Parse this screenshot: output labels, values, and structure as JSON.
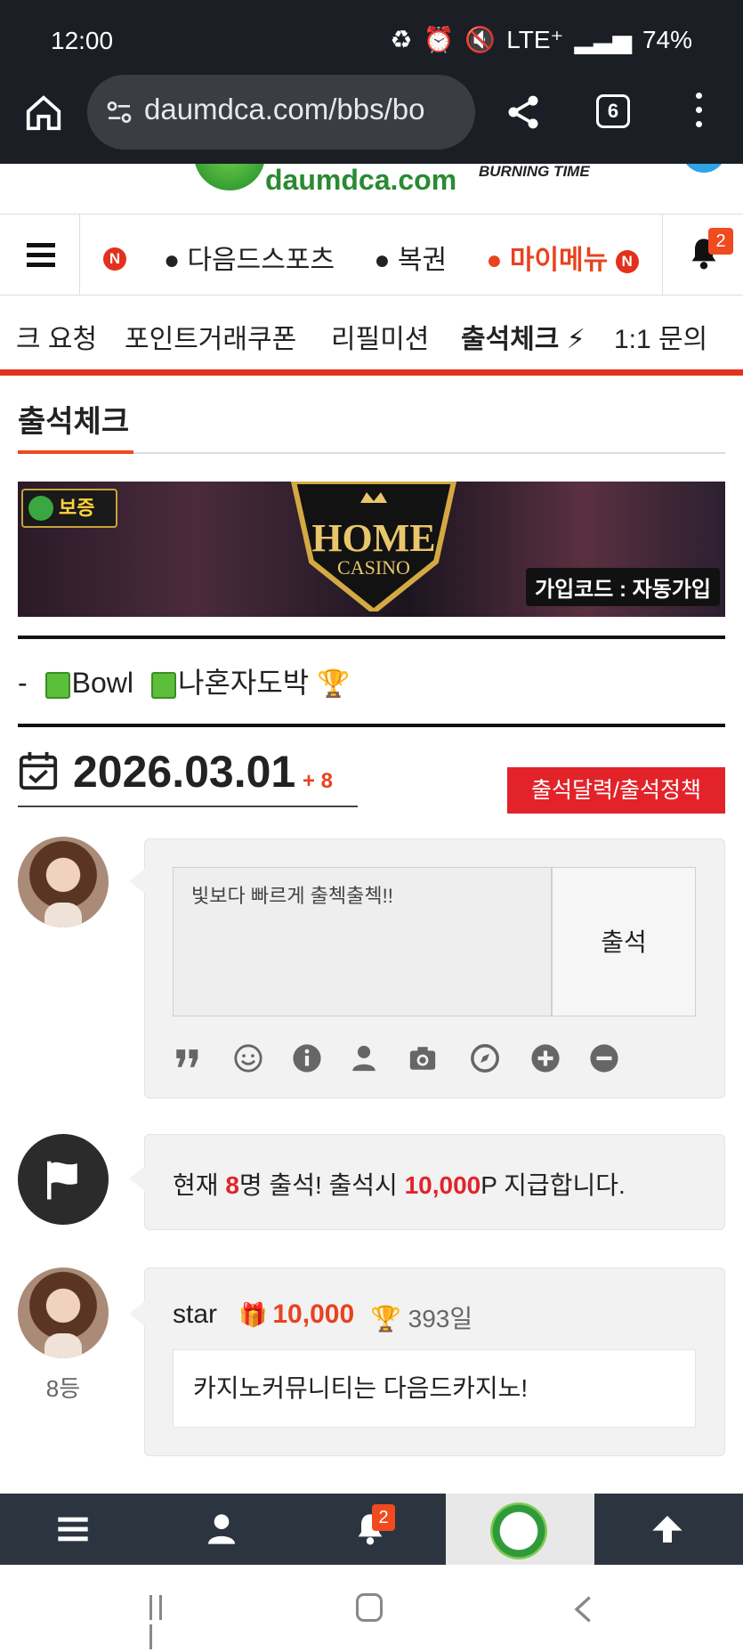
{
  "statusbar": {
    "time": "12:00",
    "network": "LTE⁺",
    "battery": "74%"
  },
  "browser": {
    "url": "daumdca.com/bbs/bo",
    "tab_count": "6"
  },
  "logo": {
    "site": "daumdca.com",
    "partner": "BURNING TIME"
  },
  "nav": {
    "new_badge": "N",
    "items": [
      "● 다음드스포츠",
      "● 복권"
    ],
    "mymenu_label": "● 마이메뉴",
    "mymenu_badge": "N",
    "notification_count": "2"
  },
  "submenu": {
    "items": [
      "크 요청",
      "포인트거래쿠폰",
      "리필미션",
      "출석체크",
      "1:1 문의"
    ],
    "active": "출석체크"
  },
  "page": {
    "title": "출석체크"
  },
  "banner": {
    "warranty": "보증",
    "brand": "HOME",
    "brand_sub": "CASINO",
    "signup_code": "가입코드 : 자동가입"
  },
  "ticker": {
    "prefix": "-",
    "item1": "Bowl",
    "item2": "나혼자도박"
  },
  "attendance": {
    "date": "2026.03.01",
    "delta": "+ 8",
    "calendar_button": "출석달력/출석정책",
    "comment_placeholder": "빛보다 빠르게 출첵출첵!!",
    "submit_button": "출석"
  },
  "notice": {
    "pre": "현재 ",
    "count": "8",
    "mid": "명 출석! 출석시 ",
    "points": "10,000",
    "post": "P 지급합니다."
  },
  "entry": {
    "rank": "8등",
    "user": "star",
    "points": "10,000",
    "days": "393일",
    "comment": "카지노커뮤니티는 다음드카지노!"
  },
  "bottom_nav": {
    "notification_count": "2"
  },
  "colors": {
    "accent": "#f04a1f",
    "red_button": "#e2232a",
    "dark_nav": "#2c3440",
    "statusbar": "#1b1e24"
  }
}
